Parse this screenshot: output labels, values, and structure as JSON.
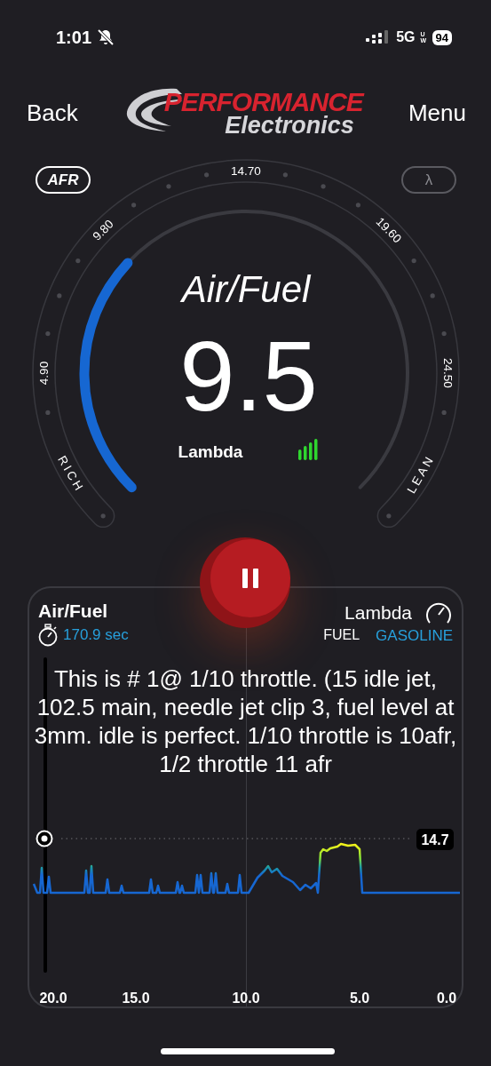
{
  "status_bar": {
    "time": "1:01",
    "network": "5G",
    "network_sub": "UW",
    "battery": "94"
  },
  "header": {
    "back": "Back",
    "menu": "Menu",
    "logo_top": "PERFORMANCE",
    "logo_bottom": "Electronics"
  },
  "gauge": {
    "modes": [
      {
        "label": "AFR",
        "selected": true
      },
      {
        "label": "λ",
        "selected": false
      }
    ],
    "scale": [
      "4.90",
      "9.80",
      "14.70",
      "19.60",
      "24.50"
    ],
    "rich": "RICH",
    "lean": "LEAN",
    "title": "Air/Fuel",
    "value": "9.5",
    "unit": "Lambda"
  },
  "log": {
    "title": "Air/Fuel",
    "duration": "170.9 sec",
    "unit": "Lambda",
    "fuel_label": "FUEL",
    "fuel_value": "GASOLINE",
    "note": "This is # 1@ 1/10 throttle. (15 idle jet, 102.5 main, needle jet clip 3, fuel level at 3mm. idle is perfect. 1/10 throttle is 10afr, 1/2 throttle 11 afr",
    "reference": "14.7",
    "x_labels": [
      "20.0",
      "15.0",
      "10.0",
      "5.0",
      "0.0"
    ]
  }
}
